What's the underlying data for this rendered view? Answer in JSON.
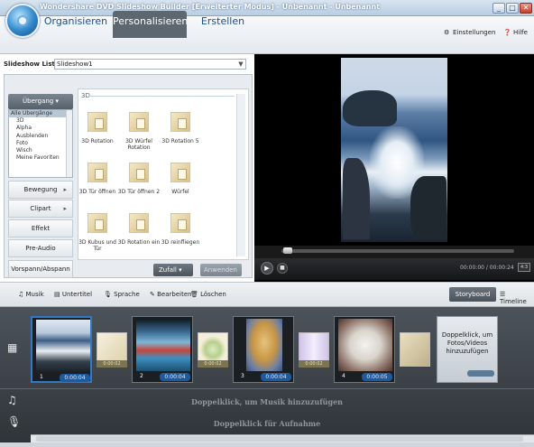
{
  "window": {
    "title": "Wondershare DVD Slideshow Builder [Erweiterter Modus] - Unbenannt - Unbenannt",
    "min": "_",
    "max": "□",
    "close": "✕"
  },
  "nav": {
    "tabs": [
      "Organisieren",
      "Personalisieren",
      "Erstellen"
    ],
    "active": "Personalisieren",
    "settings_label": "Einstellungen",
    "help_label": "Hilfe"
  },
  "slideshow_list": {
    "label": "Slideshow Liste",
    "value": "Slideshow1"
  },
  "side_menu": {
    "uebergang": "Übergang",
    "transition_list": [
      "Alle Übergänge",
      "3D",
      "Alpha",
      "Ausblenden",
      "Foto",
      "Wisch",
      "Meine Favoriten"
    ],
    "buttons": [
      "Bewegung",
      "Clipart",
      "Effekt",
      "Pre-Audio",
      "Vorspann/Abspann"
    ]
  },
  "effects": {
    "group": "3D",
    "items": [
      "3D Rotation",
      "3D Würfel Rotation",
      "3D Rotation 5",
      "3D Tür öffnen",
      "3D Tür öffnen 2",
      "Würfel",
      "3D Kubus und Tür",
      "3D Rotation ein",
      "3D reinfliegen"
    ],
    "zufall": "Zufall",
    "anwenden": "Anwenden"
  },
  "player": {
    "time": "00:00:00 / 00:00:24",
    "fullscreen": "4:3"
  },
  "toolbar": {
    "musik": "Musik",
    "untertitel": "Untertitel",
    "sprache": "Sprache",
    "bearbeiten": "Bearbeiten",
    "loeschen": "Löschen",
    "storyboard": "Storyboard",
    "timeline": "Timeline"
  },
  "slides": [
    {
      "num": "1",
      "dur": "0:00:04"
    },
    {
      "num": "2",
      "dur": "0:00:04"
    },
    {
      "num": "3",
      "dur": "0:00:04"
    },
    {
      "num": "4",
      "dur": "0:00:05"
    }
  ],
  "transitions": [
    "0:00:02",
    "0:00:02",
    "0:00:02"
  ],
  "add_box": "Doppelklick, um Fotos/Videos hinzuzufügen",
  "hints": {
    "musik": "Doppelklick, um Musik hinzuzufügen",
    "aufnahme": "Doppelklick für Aufnahme"
  },
  "colors": {
    "accent": "#1e5aa0",
    "active_tab": "#5d6770",
    "selection": "#2f79c8"
  }
}
